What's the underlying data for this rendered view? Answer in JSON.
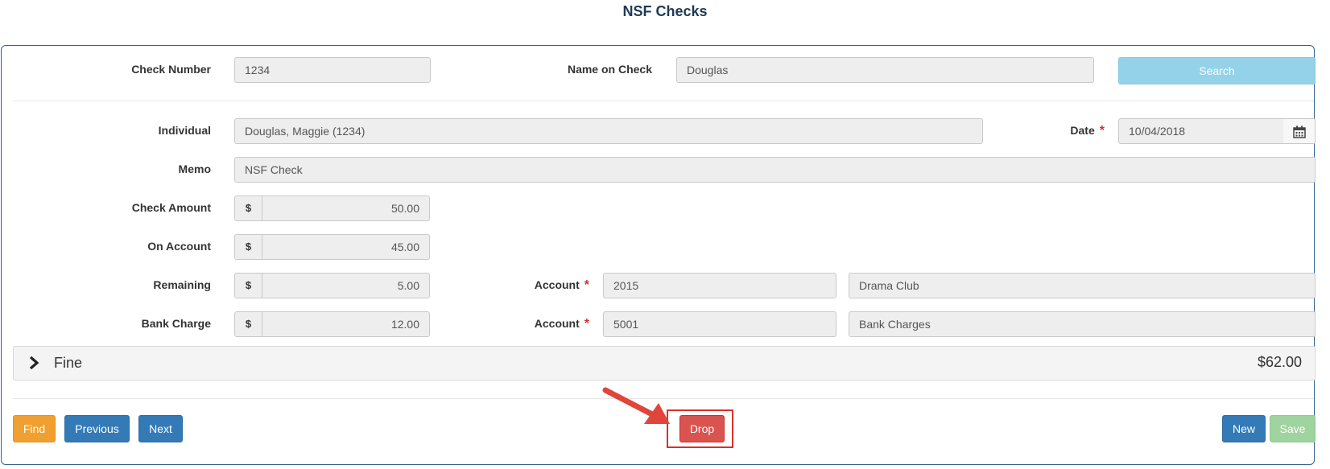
{
  "page": {
    "title": "NSF Checks"
  },
  "search_row": {
    "check_number_label": "Check Number",
    "check_number_value": "1234",
    "name_on_check_label": "Name on Check",
    "name_on_check_value": "Douglas",
    "search_label": "Search"
  },
  "form": {
    "individual_label": "Individual",
    "individual_value": "Douglas, Maggie (1234)",
    "date_label": "Date",
    "date_value": "10/04/2018",
    "memo_label": "Memo",
    "memo_value": "NSF Check",
    "currency_symbol": "$",
    "check_amount_label": "Check Amount",
    "check_amount_value": "50.00",
    "on_account_label": "On Account",
    "on_account_value": "45.00",
    "remaining_label": "Remaining",
    "remaining_value": "5.00",
    "bank_charge_label": "Bank Charge",
    "bank_charge_value": "12.00",
    "account_label": "Account",
    "remaining_account_number": "2015",
    "remaining_account_name": "Drama Club",
    "bank_account_number": "5001",
    "bank_account_name": "Bank Charges",
    "required_marker": "*"
  },
  "fine": {
    "label": "Fine",
    "total": "$62.00"
  },
  "actions": {
    "find": "Find",
    "previous": "Previous",
    "next": "Next",
    "drop": "Drop",
    "new": "New",
    "save": "Save"
  },
  "colors": {
    "primary": "#337ab7",
    "warning": "#f0a030",
    "danger": "#d9534f",
    "success_disabled": "#9fd39f",
    "info_disabled": "#93d2e8",
    "annotation": "#d9302b"
  },
  "icons": [
    "calendar-icon",
    "chevron-right-icon",
    "annotation-arrow"
  ]
}
